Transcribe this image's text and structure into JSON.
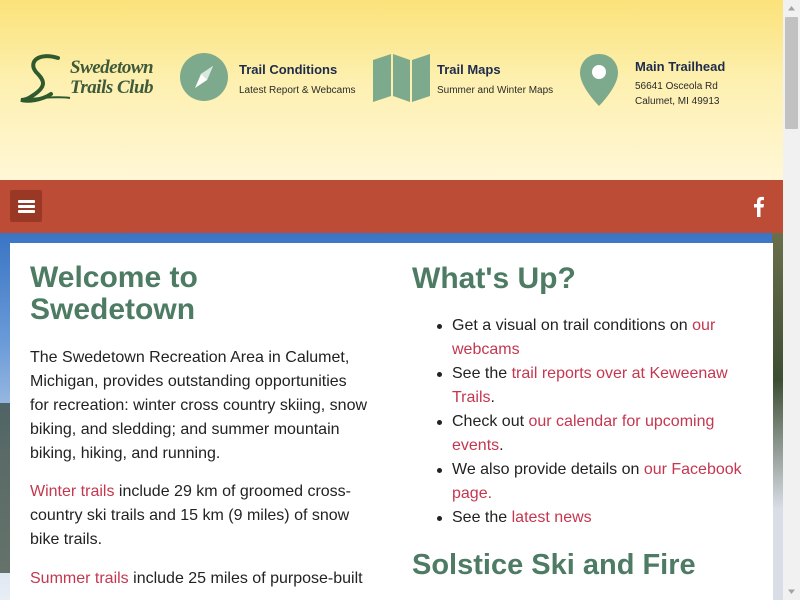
{
  "logo": {
    "line1": "Swedetown",
    "line2": "Trails Club"
  },
  "header_items": {
    "conditions": {
      "title": "Trail Conditions",
      "sub": "Latest Report & Webcams"
    },
    "maps": {
      "title": "Trail Maps",
      "sub": "Summer and Winter Maps"
    },
    "trailhead": {
      "title": "Main Trailhead",
      "line1": "56641 Osceola Rd",
      "line2": "Calumet, MI 49913"
    }
  },
  "nav": {
    "menu_icon": "hamburger-icon",
    "social_icon": "facebook-icon"
  },
  "left": {
    "heading_line1": "Welcome to",
    "heading_line2": "Swedetown",
    "intro": [
      "The Swedetown Recreation Area in Calumet,",
      "Michigan, provides outstanding opportunities",
      "for recreation: winter cross country skiing, snow",
      "biking, and sledding; and summer mountain",
      "biking, hiking, and running."
    ],
    "winter_link": "Winter trails",
    "winter_rest": [
      " include 29 km of groomed cross-",
      "country ski trails and 15 km (9 miles) of snow",
      "bike trails."
    ],
    "summer_link": "Summer trails",
    "summer_rest": " include 25 miles of purpose-built"
  },
  "right": {
    "heading": "What's Up?",
    "items": [
      {
        "pre": "Get a visual on trail conditions on ",
        "link1": "our",
        "link2": "webcams",
        "post": ""
      },
      {
        "pre": "See the ",
        "link1": "trail reports over at Keweenaw",
        "link2": "Trails",
        "post": "."
      },
      {
        "pre": "Check out ",
        "link1": "our calendar for upcoming",
        "link2": "events",
        "post": "."
      },
      {
        "pre": "We also provide details on ",
        "link1": "our Facebook",
        "link2": "page.",
        "post": ""
      },
      {
        "pre": "See the ",
        "link1": "latest news",
        "link2": "",
        "post": ""
      }
    ],
    "heading2": "Solstice Ski and Fire"
  },
  "colors": {
    "brand_green": "#4e7b63",
    "nav_red": "#bd4c36",
    "link": "#c4374f",
    "icon_green": "#7daa8d"
  }
}
